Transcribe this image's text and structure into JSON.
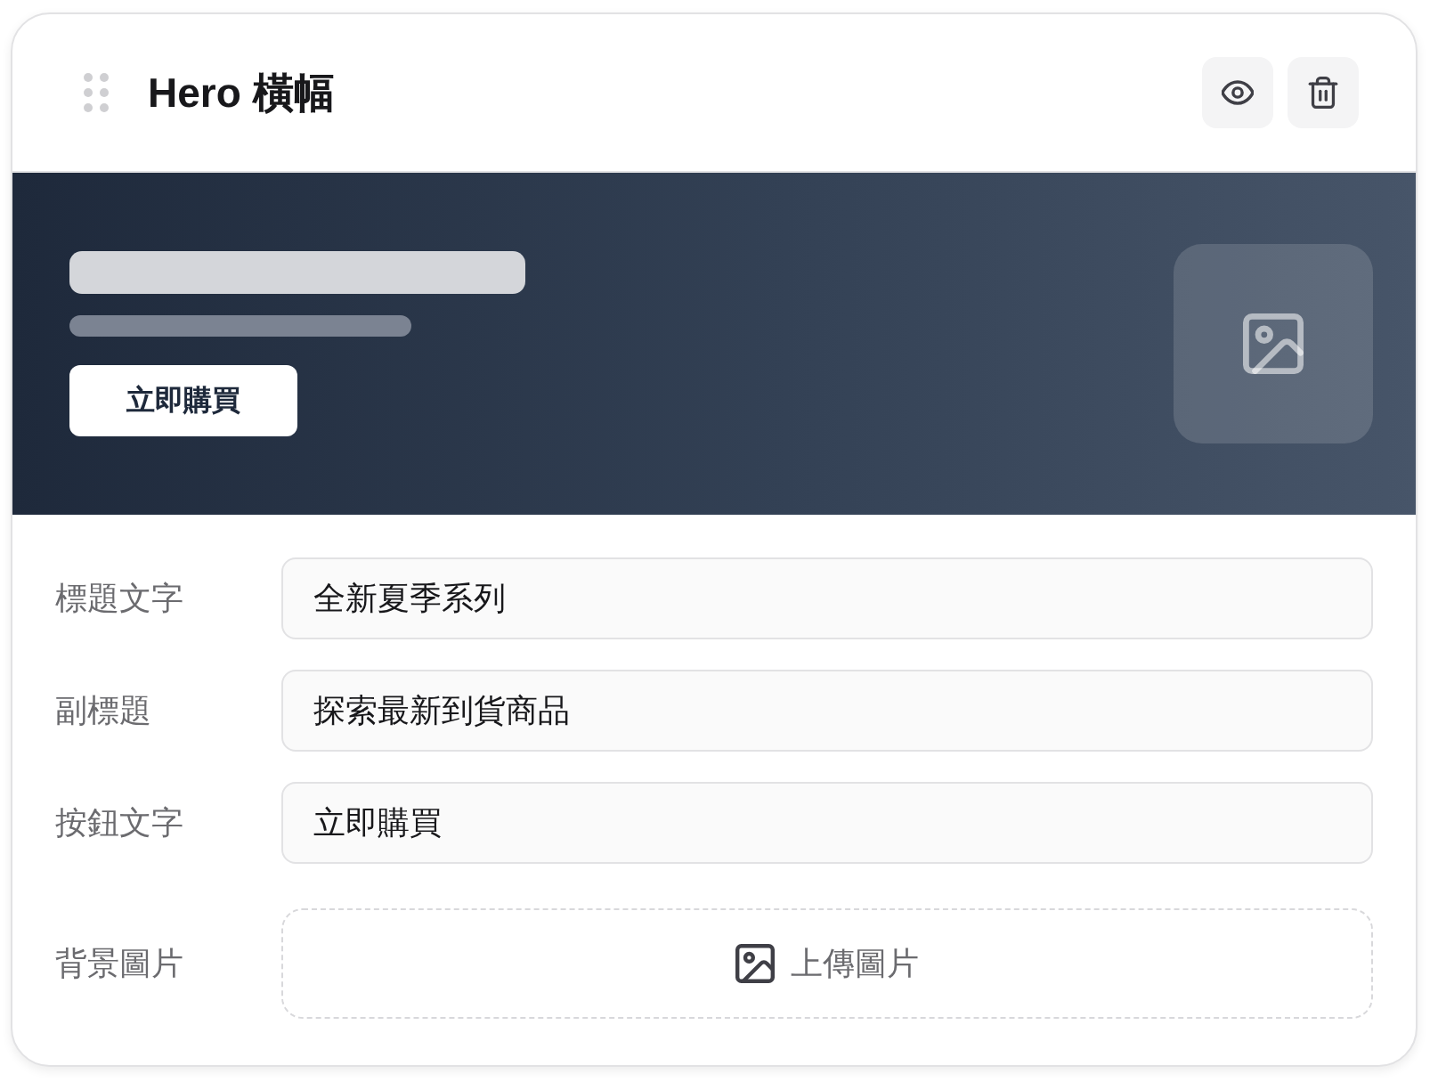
{
  "header": {
    "title": "Hero 橫幅"
  },
  "preview": {
    "button_label": "立即購買"
  },
  "fields": [
    {
      "kind": "text",
      "label": "標題文字",
      "value": "全新夏季系列"
    },
    {
      "kind": "text",
      "label": "副標題",
      "value": "探索最新到貨商品"
    },
    {
      "kind": "text",
      "label": "按鈕文字",
      "value": "立即購買"
    },
    {
      "kind": "upload",
      "label": "背景圖片",
      "button_label": "上傳圖片"
    }
  ]
}
